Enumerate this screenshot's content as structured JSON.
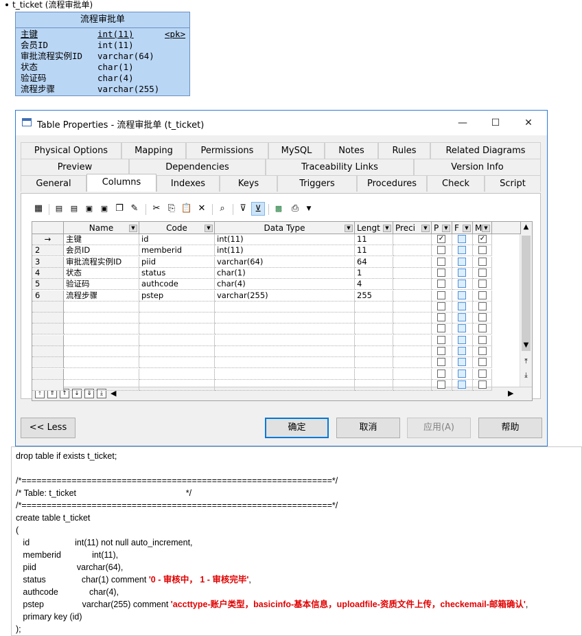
{
  "doc": {
    "bullet": "t_ticket (流程审批单)"
  },
  "entity": {
    "title": "流程审批单",
    "columns": [
      {
        "name": "主键",
        "type": "int(11)",
        "key": "<pk>"
      },
      {
        "name": "会员ID",
        "type": "int(11)",
        "key": ""
      },
      {
        "name": "审批流程实例ID",
        "type": "varchar(64)",
        "key": ""
      },
      {
        "name": "状态",
        "type": "char(1)",
        "key": ""
      },
      {
        "name": "验证码",
        "type": "char(4)",
        "key": ""
      },
      {
        "name": "流程步骤",
        "type": "varchar(255)",
        "key": ""
      }
    ]
  },
  "dialog": {
    "title": "Table Properties - 流程审批单 (t_ticket)",
    "window_buttons": {
      "minimize": "—",
      "maximize": "☐",
      "close": "✕"
    },
    "tabs_row1": [
      "Physical Options",
      "Mapping",
      "Permissions",
      "MySQL",
      "Notes",
      "Rules",
      "Related Diagrams"
    ],
    "tabs_row2": [
      "Preview",
      "Dependencies",
      "Traceability Links",
      "Version Info"
    ],
    "tabs_row3": [
      "General",
      "Columns",
      "Indexes",
      "Keys",
      "Triggers",
      "Procedures",
      "Check",
      "Script"
    ],
    "active_tab": "Columns",
    "grid": {
      "headers": [
        "Name",
        "Code",
        "Data Type",
        "Lengt",
        "Preci",
        "P",
        "F",
        "M"
      ],
      "rows": [
        {
          "num": "→",
          "name": "主键",
          "code": "id",
          "type": "int(11)",
          "length": "11",
          "p": true,
          "m": true
        },
        {
          "num": "2",
          "name": "会员ID",
          "code": "memberid",
          "type": "int(11)",
          "length": "11",
          "p": false,
          "m": false
        },
        {
          "num": "3",
          "name": "审批流程实例ID",
          "code": "piid",
          "type": "varchar(64)",
          "length": "64",
          "p": false,
          "m": false
        },
        {
          "num": "4",
          "name": "状态",
          "code": "status",
          "type": "char(1)",
          "length": "1",
          "p": false,
          "m": false
        },
        {
          "num": "5",
          "name": "验证码",
          "code": "authcode",
          "type": "char(4)",
          "length": "4",
          "p": false,
          "m": false
        },
        {
          "num": "6",
          "name": "流程步骤",
          "code": "pstep",
          "type": "varchar(255)",
          "length": "255",
          "p": false,
          "m": false
        }
      ]
    },
    "buttons": {
      "less": "<< Less",
      "ok": "确定",
      "cancel": "取消",
      "apply": "应用(A)",
      "help": "帮助"
    }
  },
  "sql": {
    "lines": [
      "drop table if exists t_ticket;",
      "",
      "/*==============================================================*/",
      "/* Table: t_ticket                                              */",
      "/*==============================================================*/",
      "create table t_ticket",
      "(",
      "   id                   int(11) not null auto_increment,",
      "   memberid             int(11),",
      "   piid                 varchar(64),",
      "   status               char(1) comment ",
      "   authcode             char(4),",
      "   pstep                varchar(255) comment ",
      "   primary key (id)",
      ");"
    ],
    "status_comment": "'0 - 审核中， 1 - 审核完毕'",
    "status_tail": ",",
    "pstep_comment": "'accttype-账户类型，basicinfo-基本信息，uploadfile-资质文件上传，checkemail-邮箱确认'",
    "pstep_tail": ","
  }
}
